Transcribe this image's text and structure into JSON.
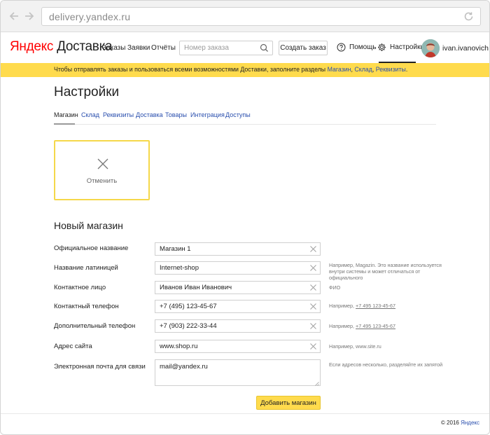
{
  "browser": {
    "url": "delivery.yandex.ru"
  },
  "header": {
    "logo_brand": "Яндекс",
    "logo_product": "Доставка",
    "nav": [
      "Заказы",
      "Заявки",
      "Отчёты"
    ],
    "search_placeholder": "Номер заказа",
    "create_order": "Создать заказ",
    "help": "Помощь",
    "settings": "Настройки",
    "username": "ivan.ivanovich"
  },
  "banner": {
    "text": "Чтобы отправлять заказы и пользоваться всеми возможностями Доставки, заполните разделы ",
    "link1": "Магазин",
    "sep1": ", ",
    "link2": "Склад",
    "sep2": ", ",
    "link3": "Реквизиты",
    "end": "."
  },
  "page": {
    "title": "Настройки",
    "tabs": [
      "Магазин",
      "Склад",
      "Реквизиты",
      "Доставка",
      "Товары",
      "Интеграция",
      "Доступы"
    ],
    "cancel_label": "Отменить",
    "section_title": "Новый магазин"
  },
  "form": {
    "official_name": {
      "label": "Официальное название",
      "value": "Магазин 1"
    },
    "latin_name": {
      "label": "Название латиницей",
      "value": "Internet-shop",
      "hint": [
        "Например, Magazin. Это название используется",
        "внутри системы и может отличаться от",
        "официального"
      ]
    },
    "contact_person": {
      "label": "Контактное лицо",
      "value": "Иванов Иван Иванович",
      "hint": "ФИО"
    },
    "phone": {
      "label": "Контактный телефон",
      "value": "+7 (495) 123-45-67",
      "hint_prefix": "Например, ",
      "hint_phone": "+7 495 123-45-67"
    },
    "extra_phone": {
      "label": "Дополнительный телефон",
      "value": "+7 (903) 222-33-44",
      "hint_prefix": "Например, ",
      "hint_phone": "+7 495 123-45-67"
    },
    "website": {
      "label": "Адрес сайта",
      "value": "www.shop.ru",
      "hint": "Например, www.site.ru"
    },
    "email": {
      "label": "Электронная почта для связи",
      "value": "mail@yandex.ru",
      "hint": "Если адресов несколько, разделяйте их запятой"
    },
    "submit": "Добавить магазин"
  },
  "footer": {
    "copyright": "© 2016",
    "brand": "Яндекс"
  }
}
